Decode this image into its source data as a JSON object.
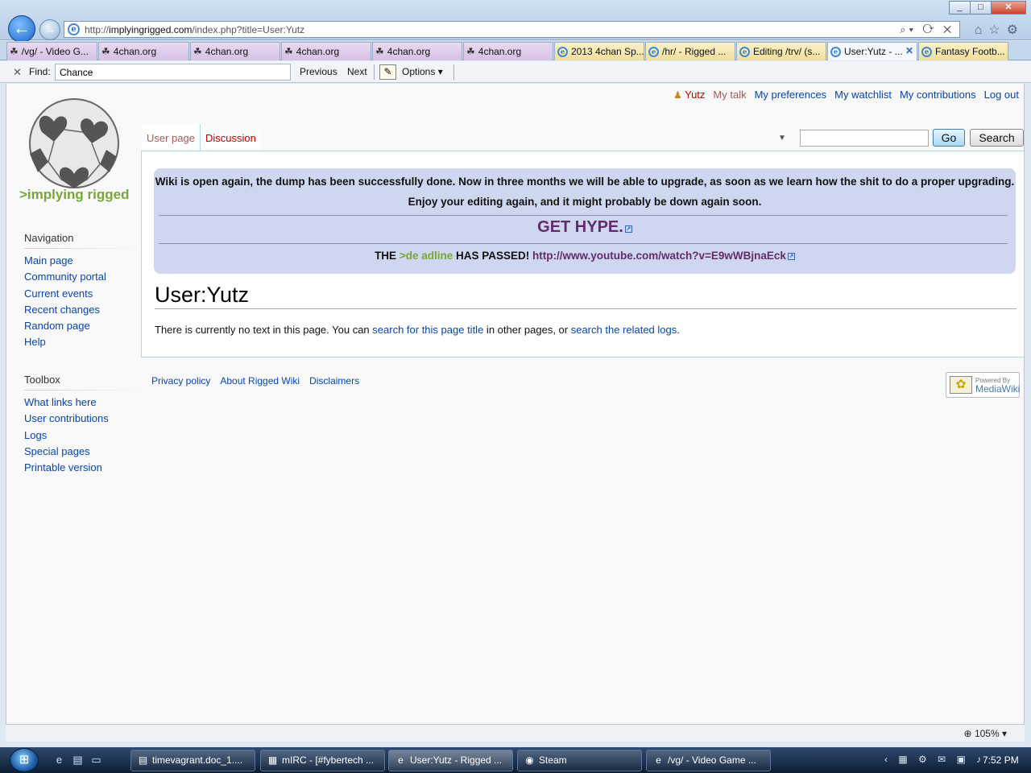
{
  "browser": {
    "url_prefix": "http://",
    "url_host": "implyingrigged.com",
    "url_path": "/index.php?title=User:Yutz",
    "tabs": [
      {
        "label": "/vg/ - Video G...",
        "icon": "clover"
      },
      {
        "label": "4chan.org",
        "icon": "clover"
      },
      {
        "label": "4chan.org",
        "icon": "clover"
      },
      {
        "label": "4chan.org",
        "icon": "clover"
      },
      {
        "label": "4chan.org",
        "icon": "clover"
      },
      {
        "label": "4chan.org",
        "icon": "clover"
      },
      {
        "label": "2013 4chan Sp...",
        "icon": "ie"
      },
      {
        "label": "/hr/ - Rigged ...",
        "icon": "ie"
      },
      {
        "label": "Editing /trv/ (s...",
        "icon": "ie"
      },
      {
        "label": "User:Yutz - ...",
        "icon": "ie"
      },
      {
        "label": "Fantasy Footb...",
        "icon": "ie"
      }
    ],
    "find": {
      "label": "Find:",
      "value": "Chance",
      "previous": "Previous",
      "next": "Next",
      "options": "Options"
    }
  },
  "wiki": {
    "site_tag": ">implying rigged",
    "personal": {
      "user": "Yutz",
      "talk": "My talk",
      "preferences": "My preferences",
      "watchlist": "My watchlist",
      "contributions": "My contributions",
      "logout": "Log out"
    },
    "navigation": {
      "title": "Navigation",
      "items": [
        "Main page",
        "Community portal",
        "Current events",
        "Recent changes",
        "Random page",
        "Help"
      ]
    },
    "toolbox": {
      "title": "Toolbox",
      "items": [
        "What links here",
        "User contributions",
        "Logs",
        "Special pages",
        "Printable version"
      ]
    },
    "tabs": {
      "user_page": "User page",
      "discussion": "Discussion"
    },
    "search": {
      "go": "Go",
      "search": "Search"
    },
    "notice": {
      "line1": "Wiki is open again, the dump has been successfully done. Now in three months we will be able to upgrade, as soon as we learn how the shit to do a proper upgrading.",
      "line2": "Enjoy your editing again, and it might probably be down again soon.",
      "hype": "GET HYPE.",
      "line3_prefix": "THE ",
      "line3_green": ">de adline",
      "line3_mid": " HAS PASSED! ",
      "line3_link": "http://www.youtube.com/watch?v=E9wWBjnaEck"
    },
    "page_title": "User:Yutz",
    "body": {
      "t1": "There is currently no text in this page. You can ",
      "link1": "search for this page title",
      "t2": " in other pages, or ",
      "link2": "search the related logs",
      "t3": "."
    },
    "footer": {
      "privacy": "Privacy policy",
      "about": "About Rigged Wiki",
      "disclaimers": "Disclaimers",
      "powered_1": "Powered By",
      "powered_2": "MediaWiki"
    }
  },
  "status": {
    "zoom": "105%"
  },
  "taskbar": {
    "items": [
      {
        "label": "timevagrant.doc_1....",
        "icon": "doc"
      },
      {
        "label": "mIRC - [#fybertech ...",
        "icon": "mirc"
      },
      {
        "label": "User:Yutz - Rigged ...",
        "icon": "ie"
      },
      {
        "label": "Steam",
        "icon": "steam"
      },
      {
        "label": "/vg/ - Video Game ...",
        "icon": "ie"
      }
    ],
    "clock": "7:52 PM"
  }
}
